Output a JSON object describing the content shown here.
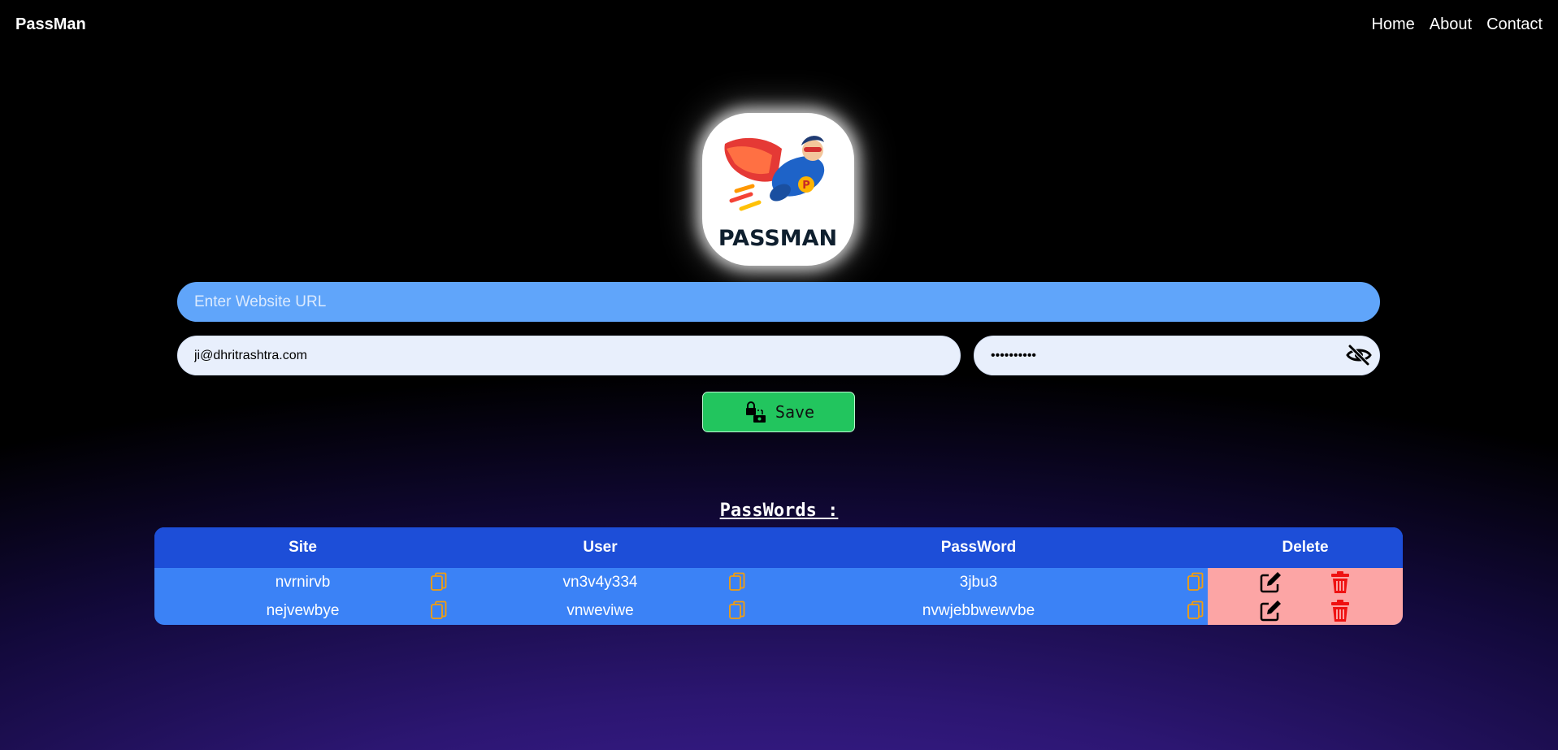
{
  "nav": {
    "brand": "PassMan",
    "links": [
      "Home",
      "About",
      "Contact"
    ]
  },
  "logo": {
    "text": "PASSMAN",
    "badge_letter": "P",
    "icon": "superhero-logo"
  },
  "form": {
    "url_placeholder": "Enter Website URL",
    "url_value": "",
    "username_value": "ji@dhritrashtra.com",
    "password_value": "••••••••••",
    "password_toggle_icon": "eye-slash-icon",
    "save_label": "Save",
    "save_icon": "lock-save-icon"
  },
  "passwords": {
    "heading": "PassWords :",
    "columns": [
      "Site",
      "User",
      "PassWord",
      "Delete"
    ],
    "rows": [
      {
        "site": "nvrnirvb",
        "user": "vn3v4y334",
        "password": "3jbu3"
      },
      {
        "site": "nejvewbye",
        "user": "vnweviwe",
        "password": "nvwjebbwewvbe"
      }
    ]
  },
  "colors": {
    "url_input": "#60a5fa",
    "save_button": "#22c55e",
    "table_header": "#1d4ed8",
    "table_body": "#3b82f6",
    "delete_cell": "#fca5a5",
    "copy_icon": "#f59e0b",
    "trash_icon": "#ef1111"
  }
}
